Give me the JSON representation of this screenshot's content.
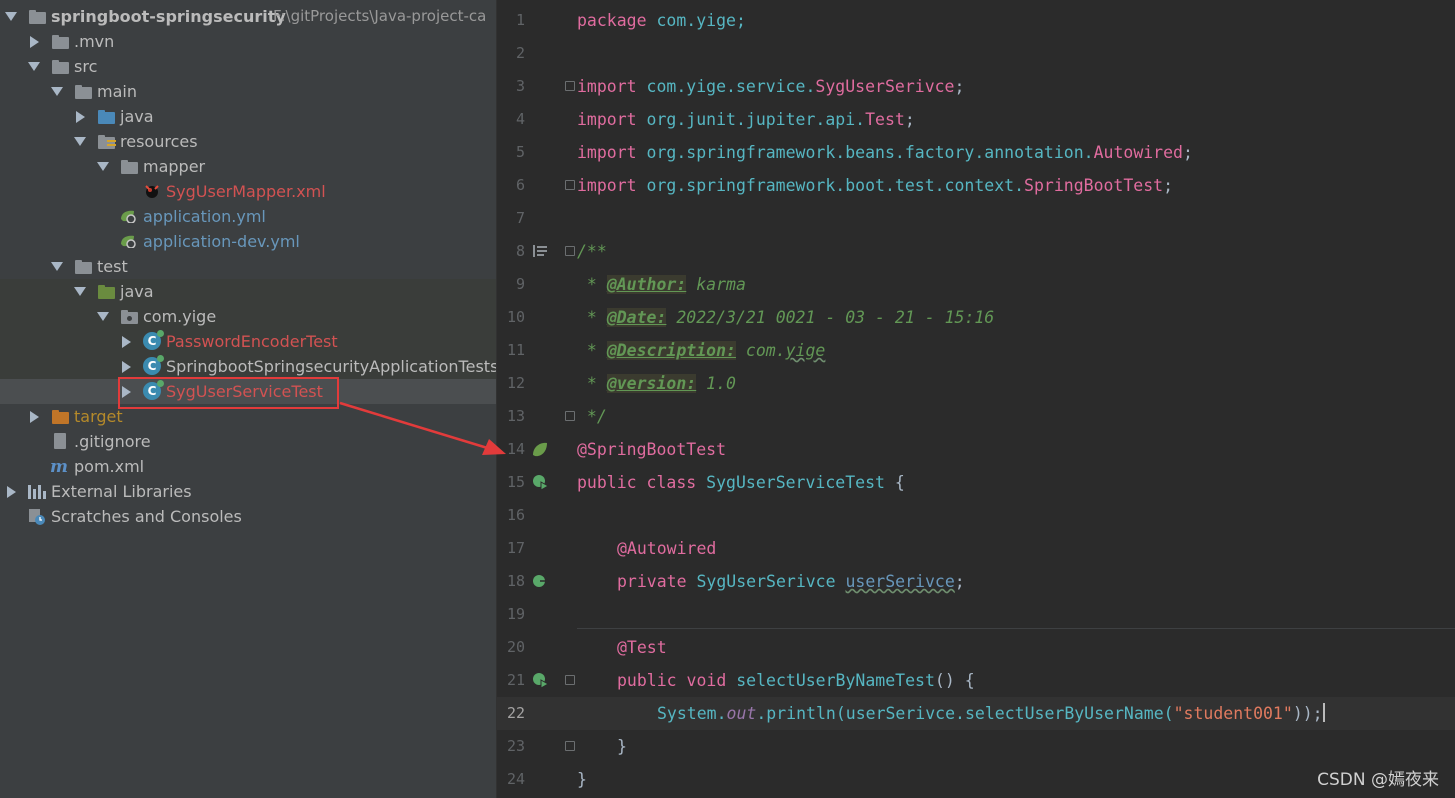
{
  "project": {
    "root_name": "springboot-springsecurity",
    "root_path": "F:\\gitProjects\\Java-project-ca",
    "mvn": ".mvn",
    "src": "src",
    "main": "main",
    "java_main": "java",
    "resources": "resources",
    "mapper": "mapper",
    "mapper_xml": "SygUserMapper.xml",
    "app_yml": "application.yml",
    "app_dev_yml": "application-dev.yml",
    "test": "test",
    "java_test": "java",
    "pkg": "com.yige",
    "test1": "PasswordEncoderTest",
    "test2": "SpringbootSpringsecurityApplicationTests",
    "test3": "SygUserServiceTest",
    "target": "target",
    "gitignore": ".gitignore",
    "pom": "pom.xml",
    "ext_libs": "External Libraries",
    "scratches": "Scratches and Consoles"
  },
  "editor": {
    "line_numbers": [
      "1",
      "2",
      "3",
      "4",
      "5",
      "6",
      "7",
      "8",
      "9",
      "10",
      "11",
      "12",
      "13",
      "14",
      "15",
      "16",
      "17",
      "18",
      "19",
      "20",
      "21",
      "22",
      "23",
      "24"
    ],
    "l1": {
      "kw": "package",
      "rest": " com.yige;"
    },
    "l3": {
      "kw": "import",
      "pkg": " com.yige.service.",
      "cls": "SygUserSerivce",
      "end": ";"
    },
    "l4": {
      "kw": "import",
      "pkg": " org.junit.jupiter.api.",
      "cls": "Test",
      "end": ";"
    },
    "l5": {
      "kw": "import",
      "pkg": " org.springframework.beans.factory.annotation.",
      "cls": "Autowired",
      "end": ";"
    },
    "l6": {
      "kw": "import",
      "pkg": " org.springframework.boot.test.context.",
      "cls": "SpringBootTest",
      "end": ";"
    },
    "l8": "/**",
    "l9": {
      "prefix": " * ",
      "tag": "@Author:",
      "val": " karma"
    },
    "l10": {
      "prefix": " * ",
      "tag": "@Date:",
      "val": " 2022/3/21 0021 - 03 - 21 - 15:16"
    },
    "l11": {
      "prefix": " * ",
      "tag": "@Description:",
      "val_pre": " com.",
      "val_wavy": "yige"
    },
    "l12": {
      "prefix": " * ",
      "tag": "@version:",
      "val": " 1.0"
    },
    "l13": " */",
    "l14": "@SpringBootTest",
    "l15": {
      "kw1": "public",
      "kw2": " class",
      "name": " SygUserServiceTest",
      "brace": " {"
    },
    "l17": "@Autowired",
    "l18": {
      "kw": "private",
      "type": " SygUserSerivce",
      "field": "userSerivce",
      "end": ";"
    },
    "l20": "@Test",
    "l21": {
      "kw1": "public",
      "kw2": " void",
      "name": " selectUserByNameTest",
      "rest": "() {"
    },
    "l22": {
      "sys": "System.",
      "out": "out",
      "println": ".println(",
      "field": "userSerivce",
      "call": ".selectUserByUserName(",
      "str": "\"student001\"",
      "end": "));"
    },
    "l23": "}",
    "l24": "}"
  },
  "watermark": "CSDN @嫣夜来"
}
